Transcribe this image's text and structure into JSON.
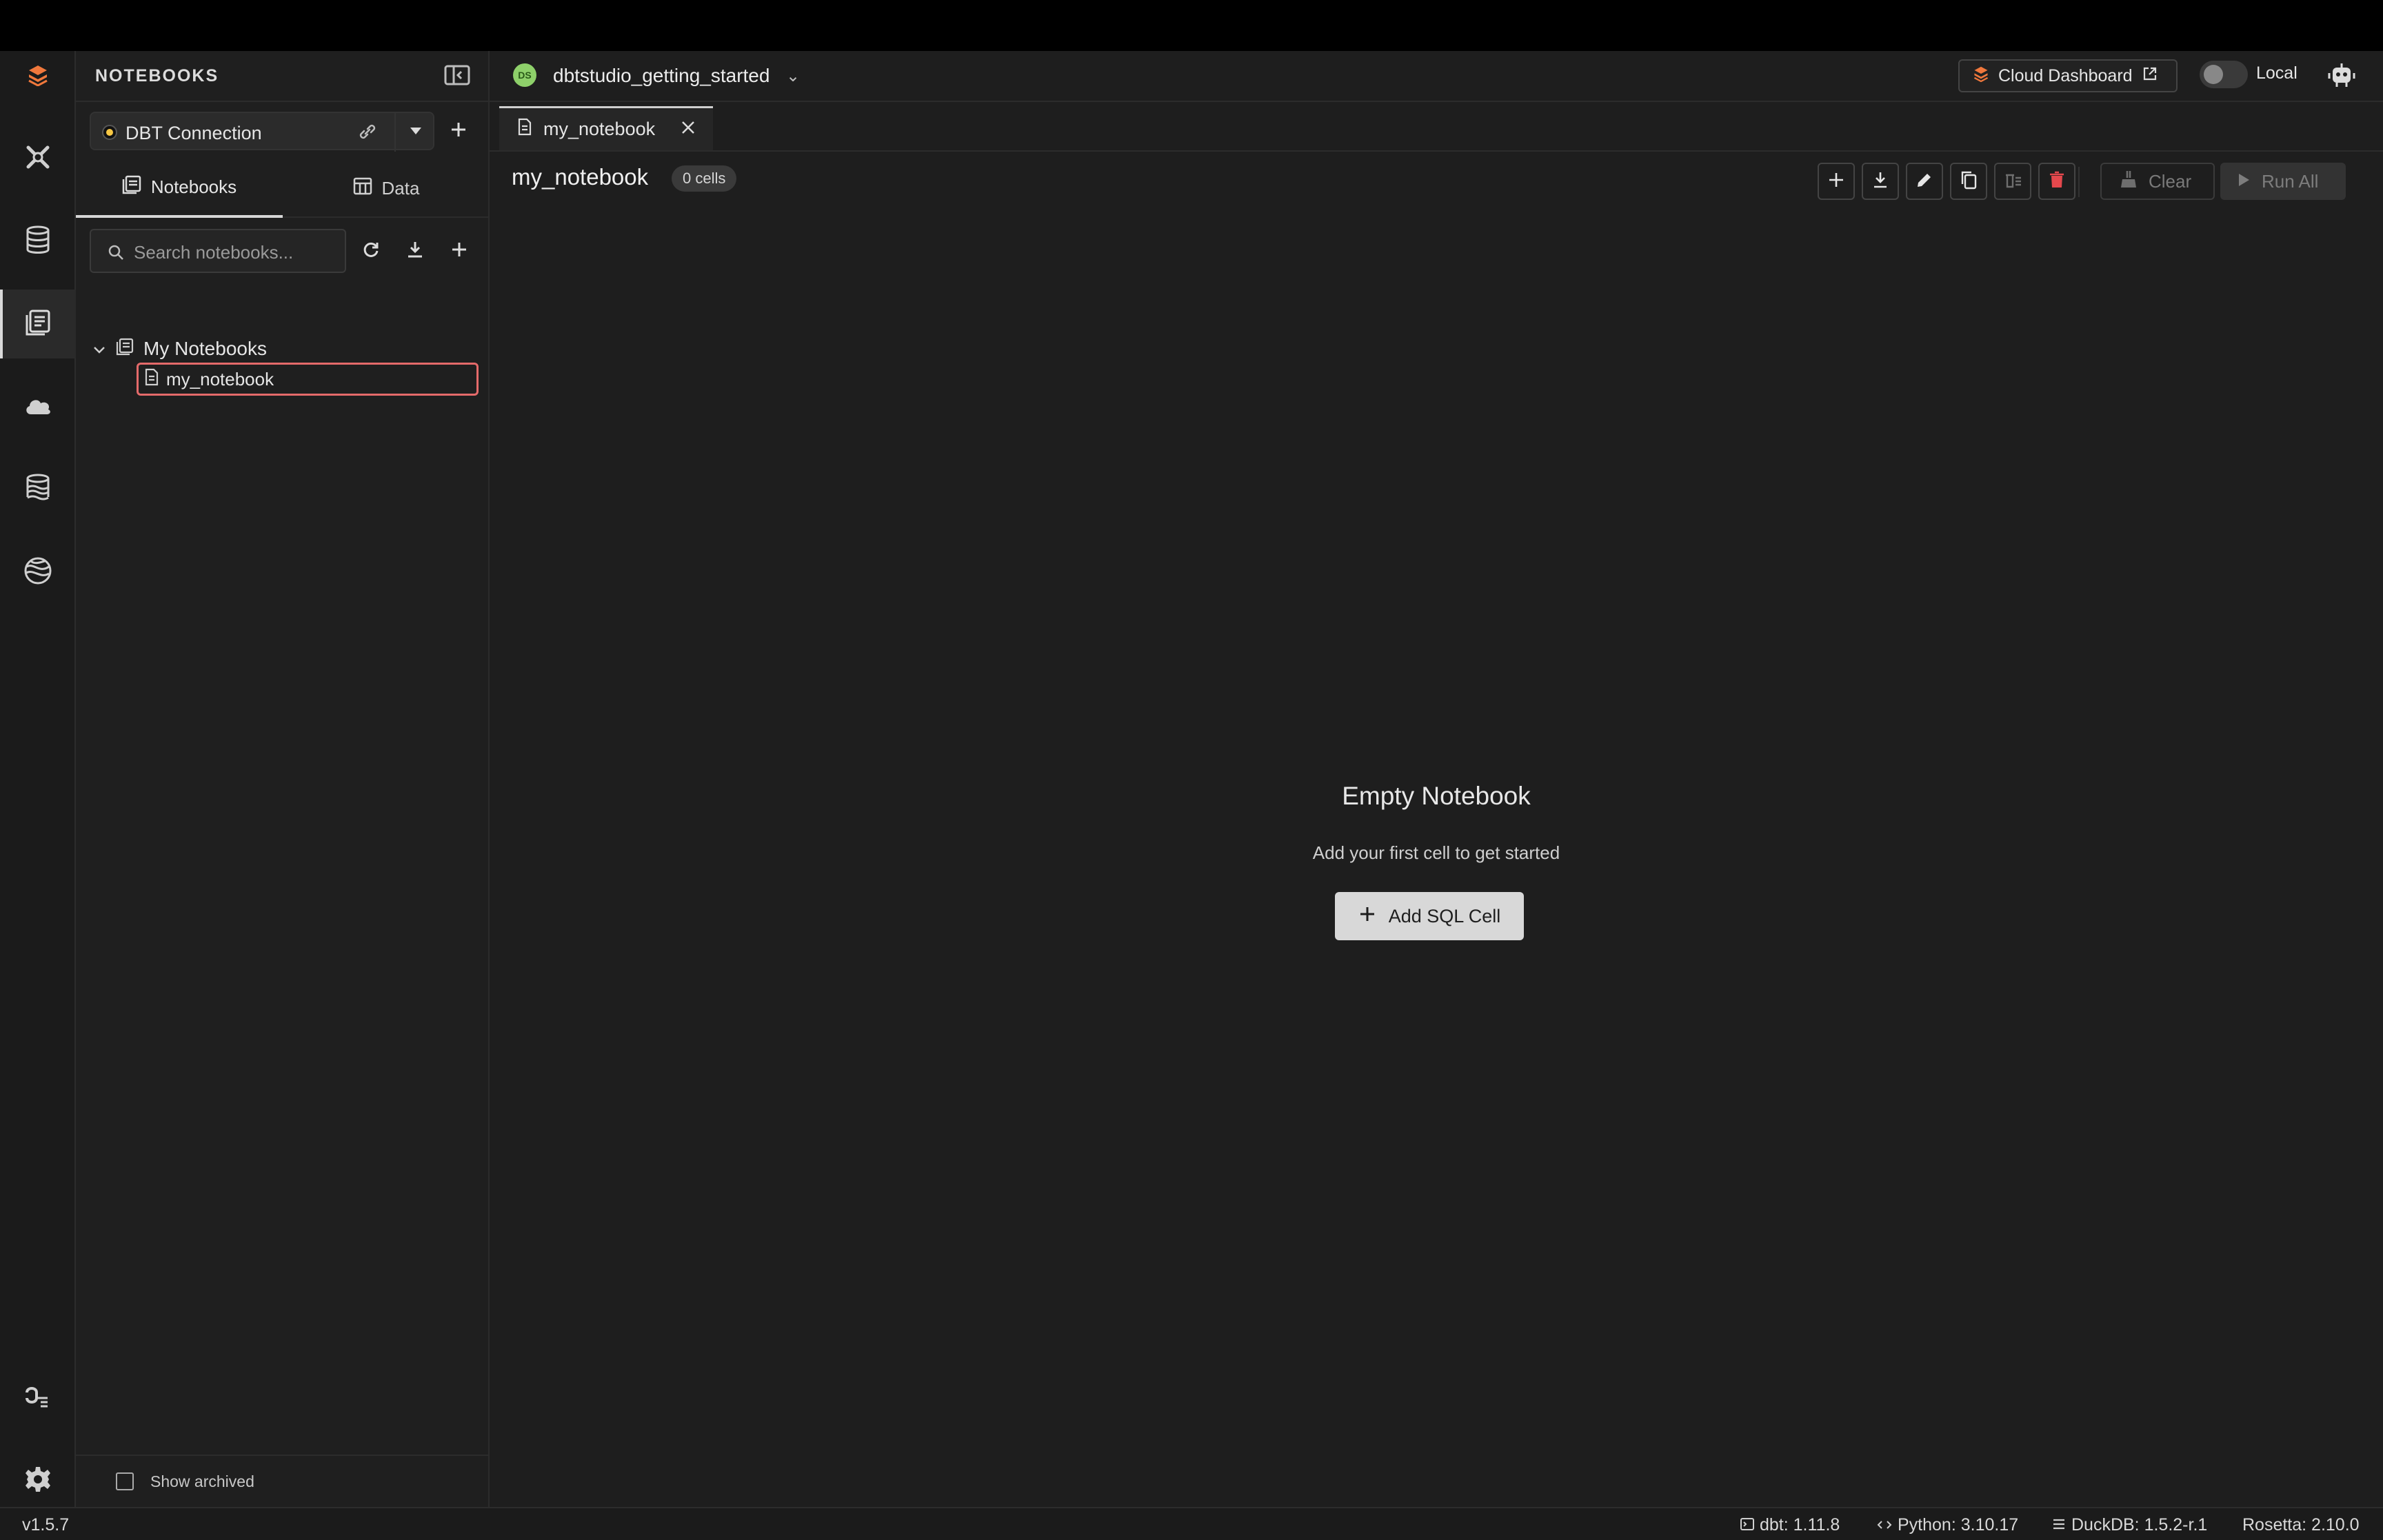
{
  "sidebar": {
    "title": "NOTEBOOKS",
    "connection": {
      "label": "DBT Connection"
    },
    "tabs": [
      {
        "label": "Notebooks"
      },
      {
        "label": "Data"
      }
    ],
    "search": {
      "placeholder": "Search notebooks..."
    },
    "tree": {
      "root": "My Notebooks",
      "items": [
        {
          "label": "my_notebook"
        }
      ]
    },
    "footer": {
      "show_archived": "Show archived"
    }
  },
  "header": {
    "project_initials": "DS",
    "project_name": "dbtstudio_getting_started",
    "project_caret": "⌄",
    "cloud_dashboard": "Cloud Dashboard",
    "mode_label": "Local"
  },
  "tabs": [
    {
      "label": "my_notebook"
    }
  ],
  "notebook": {
    "title": "my_notebook",
    "cell_count": "0 cells",
    "clear_label": "Clear",
    "run_all_label": "Run All"
  },
  "empty_state": {
    "title": "Empty Notebook",
    "subtitle": "Add your first cell to get started",
    "button": "Add SQL Cell"
  },
  "status": {
    "version": "v1.5.7",
    "dbt": "dbt: 1.11.8",
    "python": "Python: 3.10.17",
    "duckdb": "DuckDB: 1.5.2-r.1",
    "rosetta": "Rosetta: 2.10.0"
  },
  "colors": {
    "accent_logo": "#f0783c",
    "project_badge": "#8ed06a",
    "delete_red": "#e5484d",
    "selected_outline": "#e46a6a"
  },
  "icons": {
    "activity": [
      "logo-icon",
      "transform-icon",
      "database-icon",
      "notebooks-icon",
      "cloud-icon",
      "lake-icon",
      "globe-icon",
      "python-icon",
      "gear-icon"
    ]
  }
}
